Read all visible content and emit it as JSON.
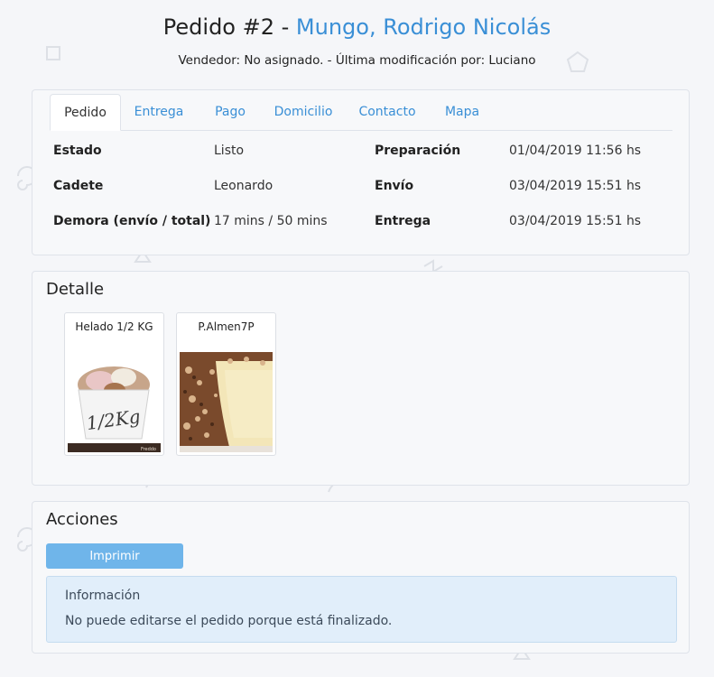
{
  "header": {
    "title_prefix": "Pedido #2 - ",
    "customer_name": "Mungo, Rodrigo Nicolás",
    "subtitle": "Vendedor: No asignado. - Última modificación por: Luciano"
  },
  "tabs": [
    {
      "label": "Pedido",
      "active": true
    },
    {
      "label": "Entrega"
    },
    {
      "label": "Pago"
    },
    {
      "label": "Domicilio"
    },
    {
      "label": "Contacto"
    },
    {
      "label": "Mapa"
    }
  ],
  "order": {
    "estado_label": "Estado",
    "estado_value": "Listo",
    "cadete_label": "Cadete",
    "cadete_value": "Leonardo",
    "demora_label": "Demora (envío / total)",
    "demora_value": "17 mins / 50 mins",
    "preparacion_label": "Preparación",
    "preparacion_value": "01/04/2019 11:56 hs",
    "envio_label": "Envío",
    "envio_value": "03/04/2019 15:51 hs",
    "entrega_label": "Entrega",
    "entrega_value": "03/04/2019 15:51 hs"
  },
  "detail": {
    "title": "Detalle",
    "products": [
      {
        "name": "Helado 1/2 KG",
        "image_text": "1/2Kg",
        "brand_text": "Freddo"
      },
      {
        "name": "P.Almen7P"
      }
    ]
  },
  "actions": {
    "title": "Acciones",
    "print_label": "Imprimir",
    "info_title": "Información",
    "info_text": "No puede editarse el pedido porque está finalizado."
  },
  "colors": {
    "accent": "#3a8fd6",
    "button": "#6fb5ea",
    "info_bg": "#e1eefa"
  }
}
